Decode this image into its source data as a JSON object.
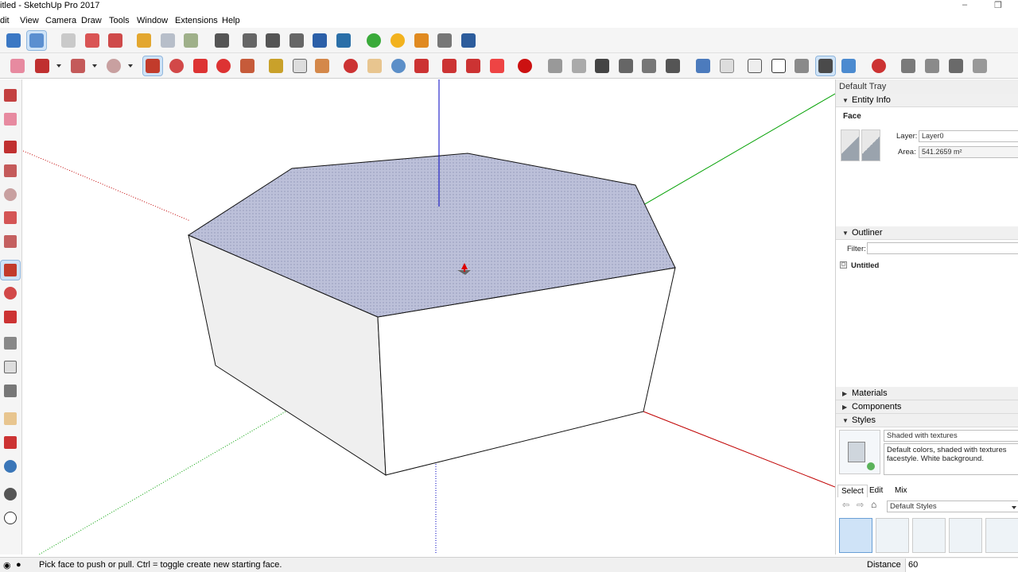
{
  "window": {
    "title": "itled - SketchUp Pro 2017",
    "minimize_glyph": "–",
    "restore_glyph": "❐"
  },
  "menu": [
    "dit",
    "View",
    "Camera",
    "Draw",
    "Tools",
    "Window",
    "Extensions",
    "Help"
  ],
  "toolbar_icons": {
    "row1": [
      "select-icon",
      "component-icon",
      "eraser-icon",
      "paint-icon",
      "box-icon",
      "section-icon",
      "solid-icon",
      "shadow-icon",
      "warehouse-icon",
      "extension-icon",
      "sandbox-icon",
      "sun-icon",
      "pencil-icon",
      "dimension-icon",
      "binoculars-icon"
    ],
    "row2": [
      "eraser-icon",
      "line-icon",
      "rectangle-icon",
      "circle-icon",
      "push-pull-icon",
      "follow-me-icon",
      "move-icon",
      "rotate-icon",
      "scale-icon",
      "tape-icon",
      "text-icon",
      "paint-bucket-icon",
      "orbit-icon",
      "pan-icon",
      "zoom-icon",
      "zoom-extents-icon",
      "warehouse-icon",
      "component-share-icon",
      "ruby-icon",
      "iso-view-icon",
      "top-view-icon",
      "front-view-icon",
      "right-view-icon",
      "back-view-icon",
      "left-view-icon",
      "xray-icon",
      "wireframe-icon",
      "hidden-line-icon",
      "shaded-icon",
      "textured-icon",
      "monochrome-icon",
      "layer-icon",
      "sandbox-icon"
    ]
  },
  "colors": {
    "top_face": "#b9bcd4",
    "axis_red": "#c00000",
    "axis_green": "#00a000",
    "axis_blue": "#0000c0",
    "active_tool": "#cfe3f7"
  },
  "tray": {
    "title": "Default Tray",
    "entity_info": {
      "header": "Entity Info",
      "type": "Face",
      "layer_label": "Layer:",
      "layer_value": "Layer0",
      "area_label": "Area:",
      "area_value": "541.2659 m²"
    },
    "outliner": {
      "header": "Outliner",
      "filter_label": "Filter:",
      "filter_value": "",
      "root": "Untitled"
    },
    "materials": {
      "header": "Materials"
    },
    "components": {
      "header": "Components"
    },
    "styles": {
      "header": "Styles",
      "name": "Shaded with textures",
      "description": "Default colors, shaded with textures facestyle. White background.",
      "tabs": [
        "Select",
        "Edit",
        "Mix"
      ],
      "library": "Default Styles"
    }
  },
  "status": {
    "message": "Pick face to push or pull.  Ctrl = toggle create new starting face.",
    "measurement_label": "Distance",
    "measurement_value": "60"
  }
}
